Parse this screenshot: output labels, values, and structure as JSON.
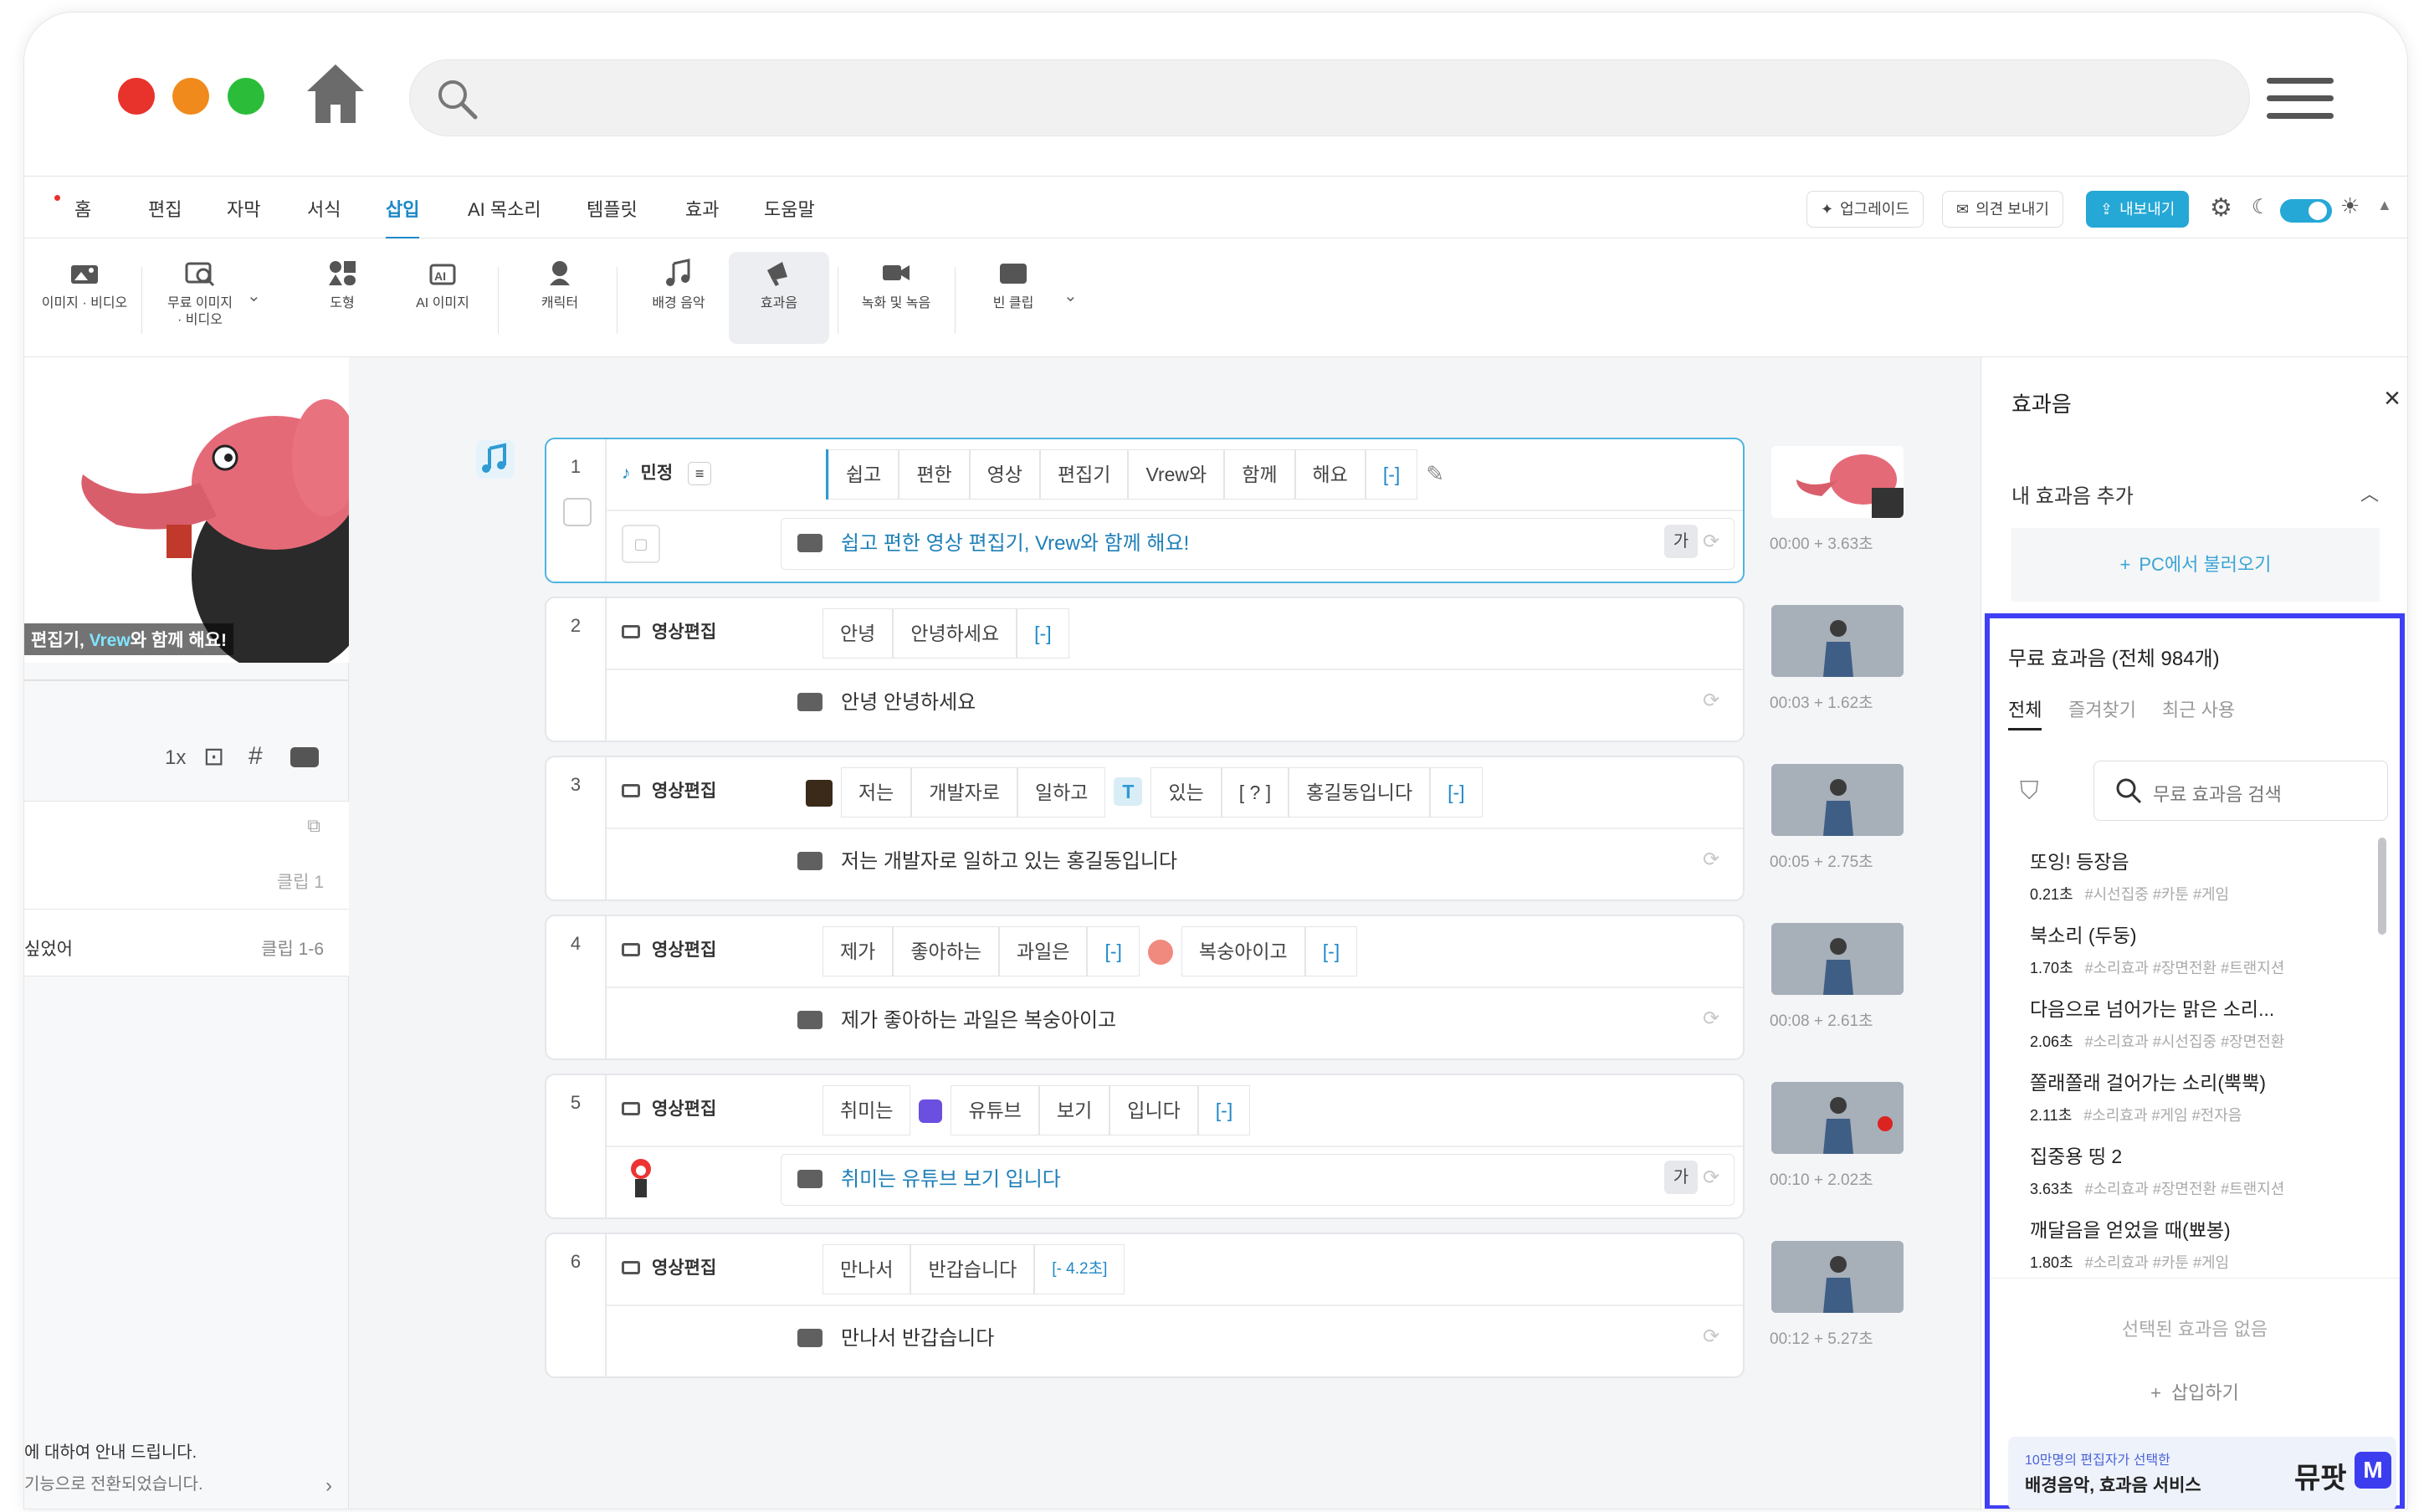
{
  "colors": {
    "accent": "#1e88c9",
    "highlight_border": "#3f3ff5",
    "export": "#25a8d6"
  },
  "menubar": {
    "items": [
      "홈",
      "편집",
      "자막",
      "서식",
      "삽입",
      "AI 목소리",
      "템플릿",
      "효과",
      "도움말"
    ],
    "upgrade": "업그레이드",
    "feedback": "의견 보내기",
    "export": "내보내기"
  },
  "toolbar": {
    "image_video": "이미지 · 비디오",
    "free_image_1": "무료 이미지",
    "free_image_2": "· 비디오",
    "shape": "도형",
    "ai_image": "AI 이미지",
    "character": "캐릭터",
    "bgm": "배경 음악",
    "sfx": "효과음",
    "record": "녹화 및 녹음",
    "blank_clip": "빈 클립"
  },
  "left": {
    "caption_pre": "편집기, ",
    "caption_hl": "Vrew",
    "caption_post": "와 함께 해요!",
    "speed": "1x",
    "clip_label_1": "클립 1",
    "clip_row_text": "싶었어",
    "clip_label_2": "클립 1-6",
    "notice_1": "에 대하여 안내 드립니다.",
    "notice_2": "기능으로 전환되었습니다."
  },
  "rows": [
    {
      "num": "1",
      "speaker": "민정",
      "words": [
        "쉽고",
        "편한",
        "영상",
        "편집기",
        "Vrew와",
        "함께",
        "해요",
        "[-]"
      ],
      "caption": "쉽고 편한 영상 편집기, Vrew와 함께 해요!",
      "gaa": "가",
      "time": "00:00 + 3.63초"
    },
    {
      "num": "2",
      "speaker": "영상편집",
      "words": [
        "안녕",
        "안녕하세요",
        "[-]"
      ],
      "caption": "안녕 안녕하세요",
      "time": "00:03 + 1.62초"
    },
    {
      "num": "3",
      "speaker": "영상편집",
      "words": [
        "저는",
        "개발자로",
        "일하고",
        "T",
        "있는",
        "[ ? ]",
        "홍길동입니다",
        "[-]"
      ],
      "caption": "저는 개발자로 일하고 있는 홍길동입니다",
      "time": "00:05 + 2.75초"
    },
    {
      "num": "4",
      "speaker": "영상편집",
      "words": [
        "제가",
        "좋아하는",
        "과일은",
        "[-]",
        "복숭아이고",
        "[-]"
      ],
      "caption": "제가 좋아하는 과일은 복숭아이고",
      "time": "00:08 + 2.61초"
    },
    {
      "num": "5",
      "speaker": "영상편집",
      "words": [
        "취미는",
        "유튜브",
        "보기",
        "입니다",
        "[-]"
      ],
      "caption": "취미는 유튜브 보기 입니다",
      "gaa": "가",
      "time": "00:10 + 2.02초"
    },
    {
      "num": "6",
      "speaker": "영상편집",
      "words": [
        "만나서",
        "반갑습니다",
        "[- 4.2초]"
      ],
      "caption": "만나서 반갑습니다",
      "time": "00:12 + 5.27초"
    }
  ],
  "right": {
    "title": "효과음",
    "add_mine": "내 효과음 추가",
    "load_pc": "PC에서 불러오기",
    "free_header": "무료 효과음 (전체 984개)",
    "tabs": [
      "전체",
      "즐겨찾기",
      "최근 사용"
    ],
    "search_placeholder": "무료 효과음 검색",
    "effects": [
      {
        "name": "또잉! 등장음",
        "dur": "0.21초",
        "tags": "#시선집중 #카툰 #게임"
      },
      {
        "name": "북소리 (두둥)",
        "dur": "1.70초",
        "tags": "#소리효과 #장면전환 #트랜지션"
      },
      {
        "name": "다음으로 넘어가는 맑은 소리...",
        "dur": "2.06초",
        "tags": "#소리효과 #시선집중 #장면전환"
      },
      {
        "name": "쫄래쫄래 걸어가는 소리(뿍뿍)",
        "dur": "2.11초",
        "tags": "#소리효과 #게임 #전자음"
      },
      {
        "name": "집중용 띵 2",
        "dur": "3.63초",
        "tags": "#소리효과 #장면전환 #트랜지션"
      },
      {
        "name": "깨달음을 얻었을 때(뾰봉)",
        "dur": "1.80초",
        "tags": "#소리효과 #카툰 #게임"
      }
    ],
    "none_selected": "선택된 효과음 없음",
    "insert": "삽입하기",
    "ad_line1": "10만명의 편집자가 선택한",
    "ad_line2": "배경음악, 효과음 서비스",
    "ad_brand": "뮤팟",
    "ad_logo": "M"
  }
}
